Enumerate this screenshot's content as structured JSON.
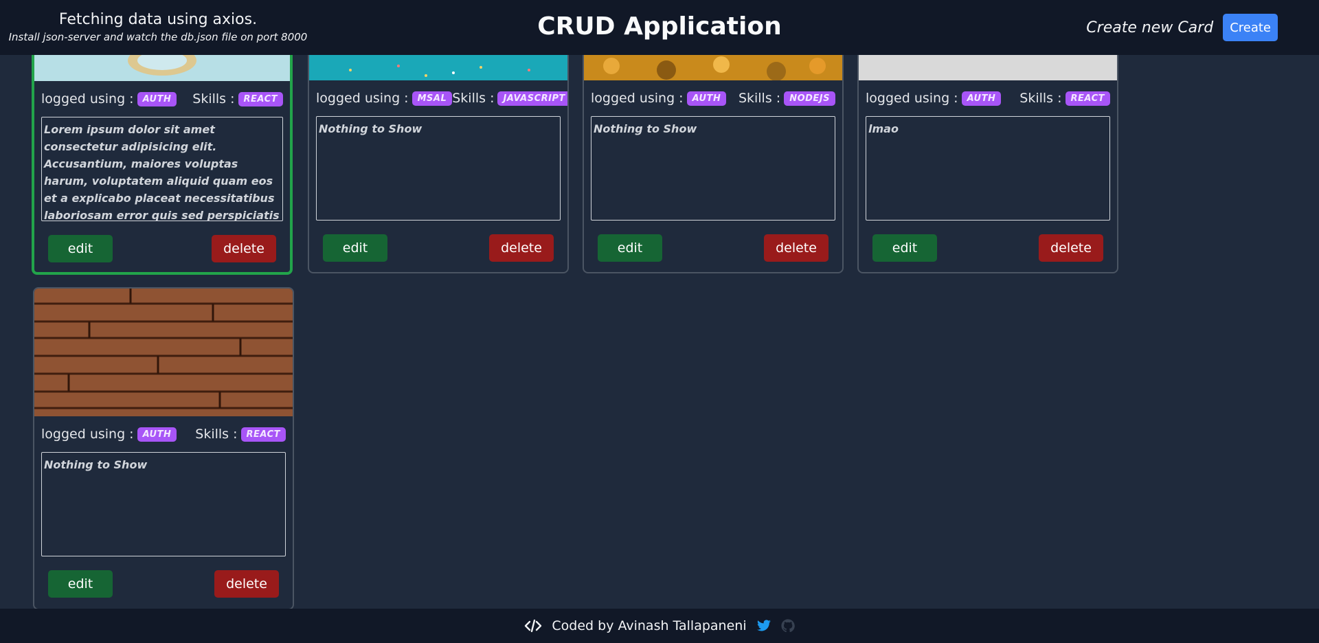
{
  "header": {
    "title": "Fetching data using axios.",
    "subtitle": "Install json-server and watch the db.json file on port 8000",
    "app_title": "CRUD Application",
    "create_label": "Create new Card",
    "create_button": "Create"
  },
  "labels": {
    "logged": "logged using :",
    "skills": "Skills :",
    "edit": "edit",
    "delete": "delete"
  },
  "cards": [
    {
      "auth": "AUTH",
      "skill": "REACT",
      "desc": "Lorem ipsum dolor sit amet consectetur adipisicing elit. Accusantium, maiores voluptas harum, voluptatem aliquid quam eos et a explicabo placeat necessitatibus laboriosam error quis sed perspiciatis possimus exercitationem. Aperiam, eum!"
    },
    {
      "auth": "MSAL",
      "skill": "JAVASCRIPT",
      "desc": "Nothing to Show"
    },
    {
      "auth": "AUTH",
      "skill": "NODEJS",
      "desc": "Nothing to Show"
    },
    {
      "auth": "AUTH",
      "skill": "REACT",
      "desc": "lmao"
    },
    {
      "auth": "AUTH",
      "skill": "REACT",
      "desc": "Nothing to Show"
    }
  ],
  "footer": {
    "credit": "Coded by Avinash Tallapaneni"
  },
  "icons": [
    "code-icon",
    "twitter-icon",
    "github-icon"
  ],
  "colors": {
    "background": "#1f2a3c",
    "header": "#111827",
    "badge": "#a855f7",
    "edit": "#166534",
    "delete": "#991b1b",
    "create": "#3b82f6",
    "active_border": "#22a44a"
  }
}
